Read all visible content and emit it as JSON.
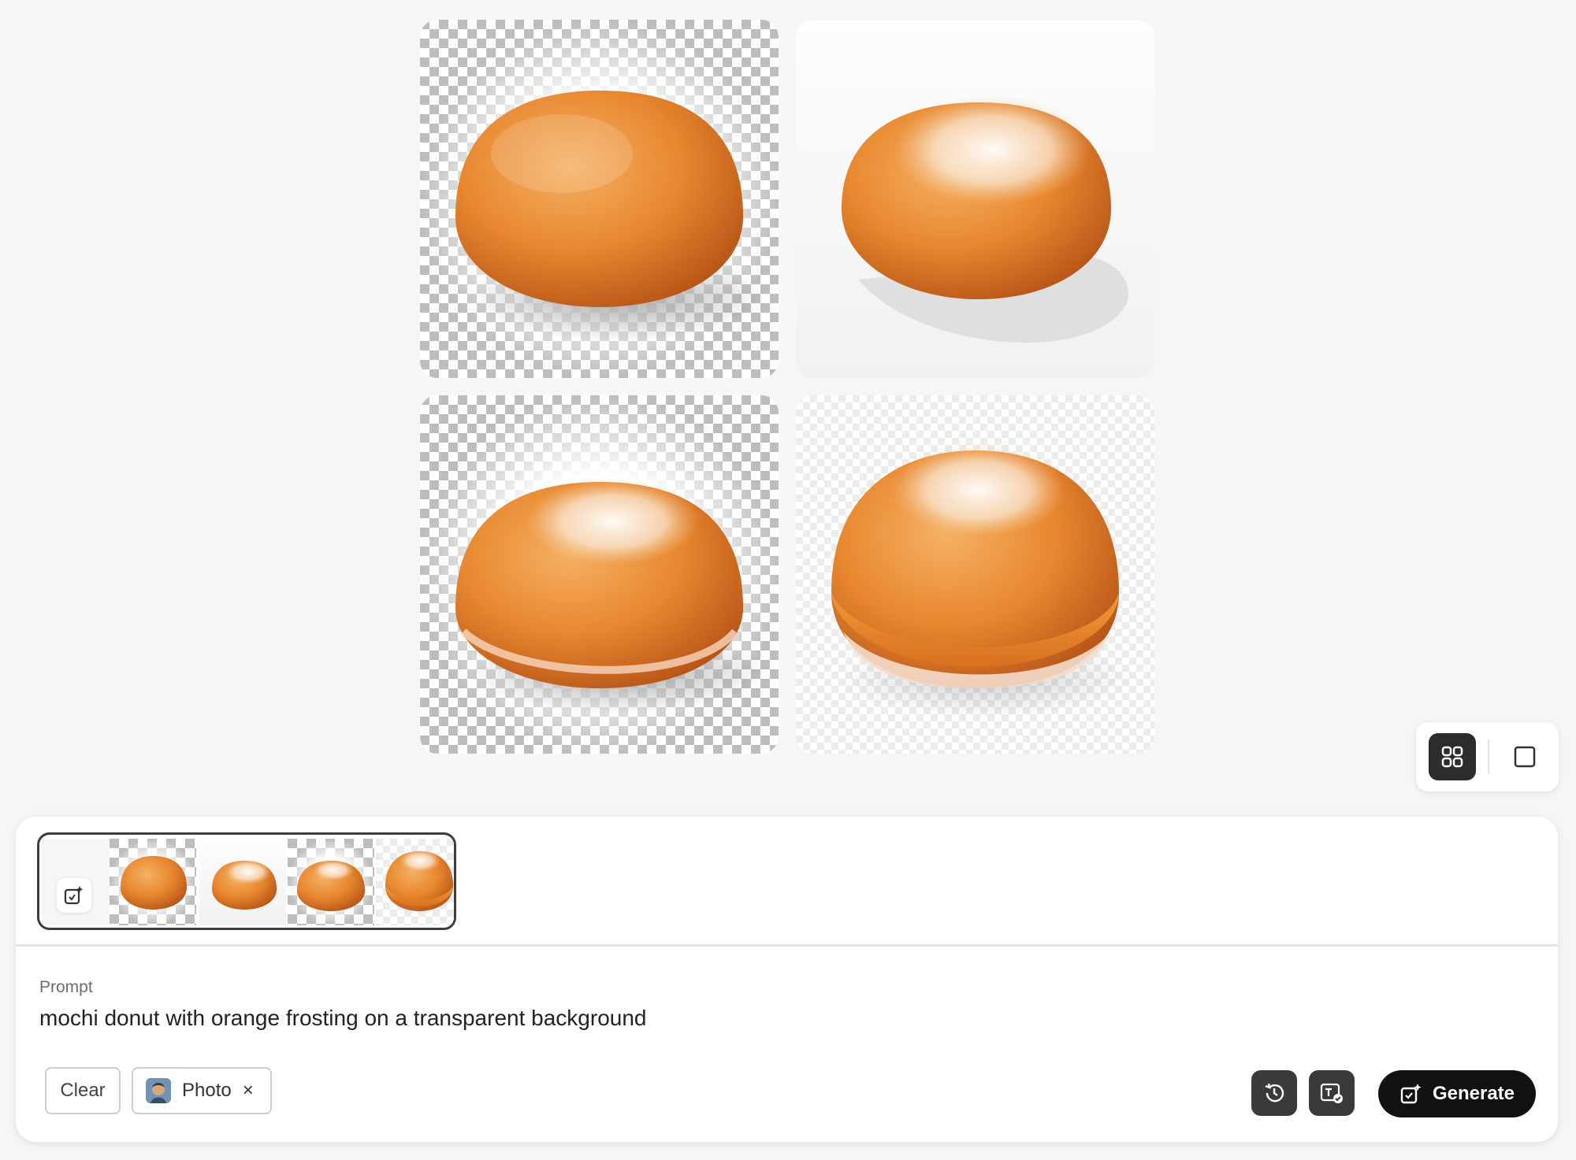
{
  "gallery": {
    "images": [
      {
        "icon": "mochi-donut-plain-image",
        "background": "transparent-checker"
      },
      {
        "icon": "mochi-donut-sugared-image",
        "background": "white"
      },
      {
        "icon": "mochi-donut-sugared-image",
        "background": "transparent-checker"
      },
      {
        "icon": "mochi-donut-glazed-image",
        "background": "transparent-checker-light"
      }
    ]
  },
  "view_toggle": {
    "active": "grid",
    "grid_icon": "grid-view-icon",
    "single_icon": "single-view-icon"
  },
  "prompt_panel": {
    "label": "Prompt",
    "text": "mochi donut with orange frosting on a transparent background",
    "clear_label": "Clear",
    "style_chip": {
      "label": "Photo",
      "close": "×"
    },
    "history_icon": "history-icon",
    "content_credentials_icon": "content-credentials-icon",
    "generate_label": "Generate"
  },
  "colors": {
    "accent_dark": "#111111",
    "icon_button": "#3a3a3a",
    "donut_orange": "#e88a32"
  }
}
